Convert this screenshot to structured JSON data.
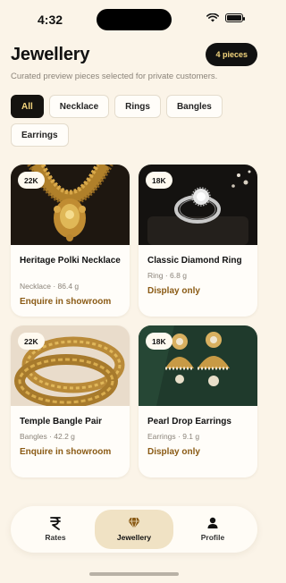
{
  "status_bar": {
    "time": "4:32"
  },
  "header": {
    "title": "Jewellery",
    "count_badge": "4 pieces",
    "subtitle": "Curated preview pieces selected for private customers."
  },
  "filters": [
    {
      "label": "All",
      "active": true
    },
    {
      "label": "Necklace",
      "active": false
    },
    {
      "label": "Rings",
      "active": false
    },
    {
      "label": "Bangles",
      "active": false
    },
    {
      "label": "Earrings",
      "active": false
    }
  ],
  "products": [
    {
      "karat": "22K",
      "name": "Heritage Polki Necklace",
      "meta": "Necklace · 86.4 g",
      "action": "Enquire in showroom",
      "icon": "necklace-photo"
    },
    {
      "karat": "18K",
      "name": "Classic Diamond Ring",
      "meta": "Ring · 6.8 g",
      "action": "Display only",
      "icon": "ring-photo"
    },
    {
      "karat": "22K",
      "name": "Temple Bangle Pair",
      "meta": "Bangles · 42.2 g",
      "action": "Enquire in showroom",
      "icon": "bangle-photo"
    },
    {
      "karat": "18K",
      "name": "Pearl Drop Earrings",
      "meta": "Earrings · 9.1 g",
      "action": "Display only",
      "icon": "earrings-photo"
    }
  ],
  "nav": [
    {
      "label": "Rates",
      "icon": "rupee-icon",
      "active": false
    },
    {
      "label": "Jewellery",
      "icon": "diamond-icon",
      "active": true
    },
    {
      "label": "Profile",
      "icon": "person-icon",
      "active": false
    }
  ],
  "colors": {
    "background": "#fbf4e8",
    "accent_gold": "#f3d57d",
    "action_brown": "#8a5a14",
    "dark": "#15130f"
  }
}
